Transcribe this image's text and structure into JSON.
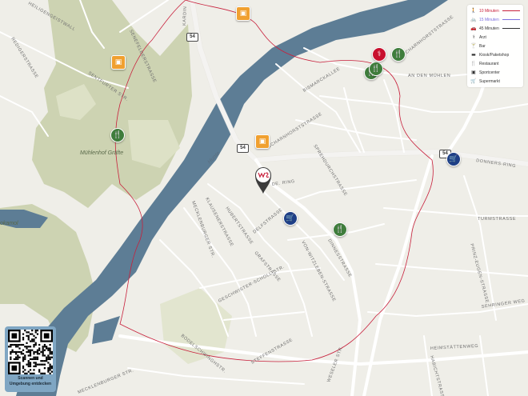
{
  "map": {
    "river_name": "Hunte",
    "place_label": "Mühlenhof Gräfte",
    "place_label_cut": "okamol",
    "road_shield": "54",
    "streets": {
      "heiligengeistwall_cut": "HEILIGENGEISTWALL",
      "redigerstrasse": "REDIGERSTRASSE",
      "senefelderstrasse": "SENEFELDERSTRASSE",
      "sentfurter": "SENTFURTER STR.",
      "scharnhorst_a": "SCHARNHORSTSTRASSE",
      "scharnhorst_b": "SCHARNHORSTSTRASSE",
      "an_den_muehlen": "AN DEN MÜHLEN",
      "bismarck": "BISMARCKALLEE",
      "sprehdurch": "SPREHDURCHSTRASSE",
      "donners_ring": "DONNERS-RING",
      "turmstrasse": "TURMSTRASSE",
      "prinz_eugen": "PRINZ-EUGEN-STRASSE",
      "ring_de": "DE. RING",
      "mecklenburger": "MECKLENBURGER STR.",
      "hubertstrasse": "HUBERTSTRASSE",
      "klausenerstrasse": "KLAUSENERSTRASSE",
      "delfstrasse": "DELFSTRASSE",
      "von_witzleben": "VON-WITZLEBEN-STRASSE",
      "dinnes": "DINNESSTRASSE",
      "geschwister_scholl": "GESCHWISTER-SCHOLL-STR.",
      "grafstrasse": "GRAFSTRASSE",
      "schieferstrasse": "SCHIEFERSTRASSE",
      "steffenstrasse": "STEFFENSTRASSE",
      "bodelschwingh": "BODELSCHWINGHSTR.",
      "wester_ring": "WESTER RING",
      "heimstaettenweg": "HEIMSTÄTTENWEG",
      "habichtstrasse": "HABICHTSTRASSE",
      "sehringer": "SEHRINGER WEG",
      "weseler": "WESELER STR.",
      "kardinal": "KARDIN"
    }
  },
  "legend": {
    "items": [
      {
        "icon": "walk-icon",
        "glyph": "🚶",
        "label": "10 Minuten",
        "line_color": "#c8203c"
      },
      {
        "icon": "bike-icon",
        "glyph": "🚲",
        "label": "15 Minuten",
        "line_color": "#7a6ee0"
      },
      {
        "icon": "car-icon",
        "glyph": "🚗",
        "label": "45 Minuten",
        "line_color": "#333333"
      },
      {
        "icon": "doctor-icon",
        "glyph": "⚕",
        "label": "Arzt",
        "line_color": ""
      },
      {
        "icon": "bar-icon",
        "glyph": "🍸",
        "label": "Bar",
        "line_color": ""
      },
      {
        "icon": "kiosk-icon",
        "glyph": "▬",
        "label": "Kiosk/Paketshop",
        "line_color": ""
      },
      {
        "icon": "restaurant-icon",
        "glyph": "🍴",
        "label": "Restaurant",
        "line_color": ""
      },
      {
        "icon": "sport-icon",
        "glyph": "▣",
        "label": "Sportcenter",
        "line_color": ""
      },
      {
        "icon": "supermarket-icon",
        "glyph": "🛒",
        "label": "Supermarkt",
        "line_color": ""
      }
    ]
  },
  "qr": {
    "line1": "Scannen und",
    "line2": "Umgebung entdecken"
  },
  "colors": {
    "land": "#efeee8",
    "water": "#5d7d95",
    "park": "#cdd3b2",
    "road": "#ffffff",
    "isochrone": "#c8203c",
    "restaurant": "#3f7d3c",
    "sport": "#f0a030",
    "supermarket": "#1e3f86",
    "doctor": "#c8102e"
  }
}
